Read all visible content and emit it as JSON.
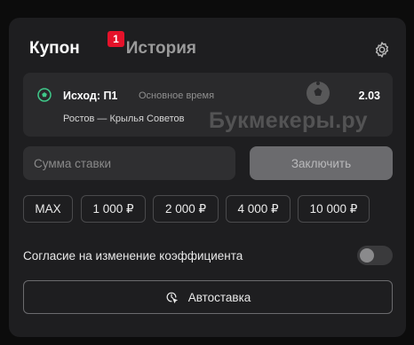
{
  "tabs": {
    "coupon": "Купон",
    "coupon_badge": "1",
    "history": "История"
  },
  "bet": {
    "outcome": "Исход: П1",
    "period": "Основное время",
    "odds": "2.03",
    "match": "Ростов — Крылья Советов"
  },
  "watermark": "Букмекеры.ру",
  "stake": {
    "placeholder": "Сумма ставки",
    "value": ""
  },
  "confirm_label": "Заключить",
  "quick_amounts": [
    "MAX",
    "1 000 ₽",
    "2 000 ₽",
    "4 000 ₽",
    "10 000 ₽"
  ],
  "consent_label": "Согласие на изменение коэффициента",
  "consent_enabled": false,
  "autobet_label": "Автоставка",
  "icons": {
    "settings": "gear-icon",
    "sport": "soccer-ball-icon",
    "autobet": "clock-cursor-icon"
  },
  "colors": {
    "accent_red": "#e5122a",
    "panel": "#1e1e20",
    "ball_green": "#3fc98a"
  }
}
